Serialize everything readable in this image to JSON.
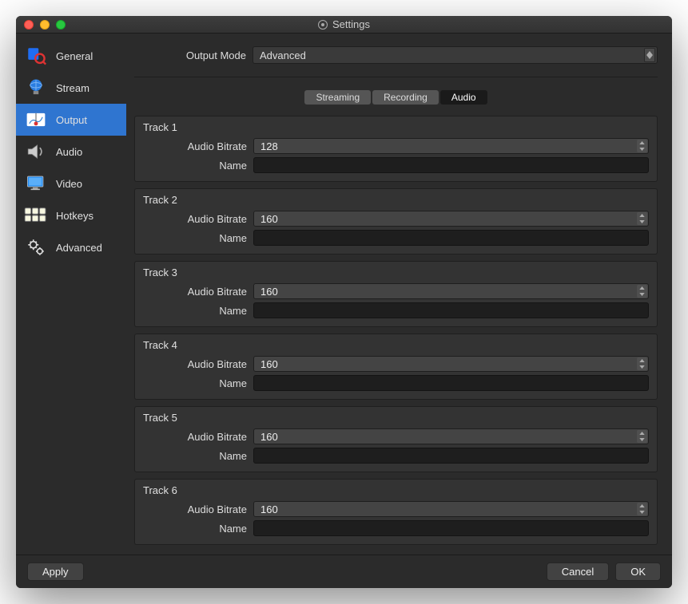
{
  "window": {
    "title": "Settings"
  },
  "sidebar": {
    "items": [
      {
        "label": "General"
      },
      {
        "label": "Stream"
      },
      {
        "label": "Output"
      },
      {
        "label": "Audio"
      },
      {
        "label": "Video"
      },
      {
        "label": "Hotkeys"
      },
      {
        "label": "Advanced"
      }
    ],
    "active_index": 2
  },
  "output_mode": {
    "label": "Output Mode",
    "value": "Advanced"
  },
  "tabs": {
    "items": [
      "Streaming",
      "Recording",
      "Audio"
    ],
    "active_index": 2
  },
  "field_labels": {
    "audio_bitrate": "Audio Bitrate",
    "name": "Name"
  },
  "tracks": [
    {
      "title": "Track 1",
      "bitrate": "128",
      "name": ""
    },
    {
      "title": "Track 2",
      "bitrate": "160",
      "name": ""
    },
    {
      "title": "Track 3",
      "bitrate": "160",
      "name": ""
    },
    {
      "title": "Track 4",
      "bitrate": "160",
      "name": ""
    },
    {
      "title": "Track 5",
      "bitrate": "160",
      "name": ""
    },
    {
      "title": "Track 6",
      "bitrate": "160",
      "name": ""
    }
  ],
  "buttons": {
    "apply": "Apply",
    "cancel": "Cancel",
    "ok": "OK"
  }
}
